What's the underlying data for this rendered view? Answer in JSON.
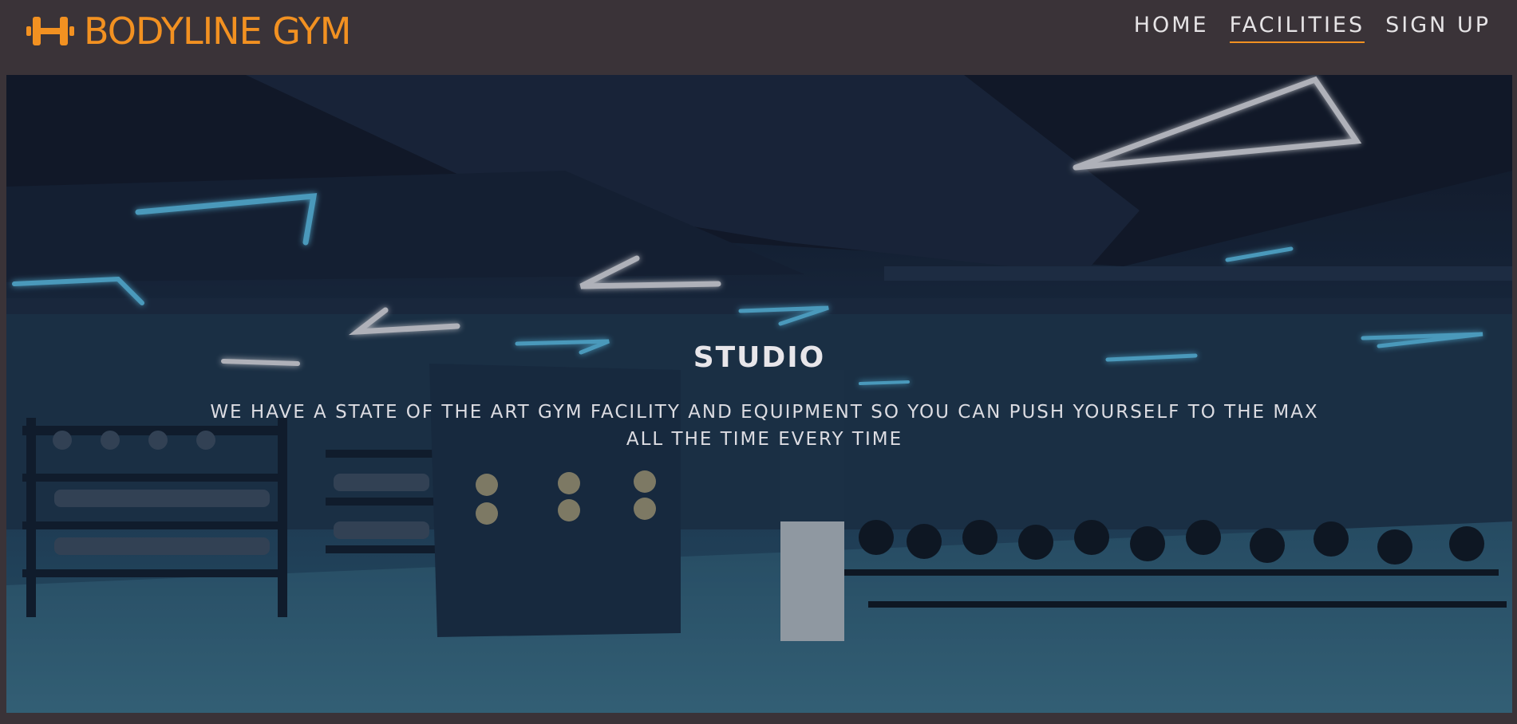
{
  "brand": {
    "name": "BODYLINE GYM",
    "icon": "dumbbell-icon",
    "color": "#f29121"
  },
  "nav": {
    "items": [
      {
        "label": "HOME",
        "active": false
      },
      {
        "label": "FACILITIES",
        "active": true
      },
      {
        "label": "SIGN UP",
        "active": false
      }
    ]
  },
  "hero": {
    "title": "STUDIO",
    "text": "WE HAVE A STATE OF THE ART GYM FACILITY AND EQUIPMENT SO YOU CAN PUSH YOURSELF TO THE MAX ALL THE TIME EVERY TIME"
  },
  "colors": {
    "header_bg": "#3a3338",
    "accent": "#f29121",
    "nav_text": "#e6e4e6"
  }
}
